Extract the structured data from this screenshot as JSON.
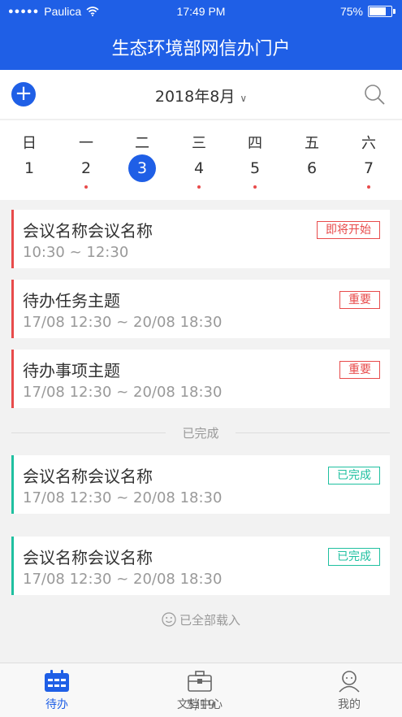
{
  "status": {
    "carrier": "Paulica",
    "time": "17:49 PM",
    "battery": "75%"
  },
  "header": {
    "title": "生态环境部网信办门户"
  },
  "toolbar": {
    "month": "2018年8月"
  },
  "week": [
    {
      "weekday": "日",
      "date": "1",
      "marked": false,
      "selected": false
    },
    {
      "weekday": "一",
      "date": "2",
      "marked": true,
      "selected": false
    },
    {
      "weekday": "二",
      "date": "3",
      "marked": false,
      "selected": true
    },
    {
      "weekday": "三",
      "date": "4",
      "marked": true,
      "selected": false
    },
    {
      "weekday": "四",
      "date": "5",
      "marked": true,
      "selected": false
    },
    {
      "weekday": "五",
      "date": "6",
      "marked": false,
      "selected": false
    },
    {
      "weekday": "六",
      "date": "7",
      "marked": true,
      "selected": false
    }
  ],
  "pending": [
    {
      "title": "会议名称会议名称",
      "time": "10:30 ~ 12:30",
      "badge": "即将开始"
    },
    {
      "title": "待办任务主题",
      "time": "17/08 12:30  ~ 20/08 18:30",
      "badge": "重要"
    },
    {
      "title": "待办事项主题",
      "time": "17/08 12:30  ~ 20/08 18:30",
      "badge": "重要"
    }
  ],
  "divider_label": "已完成",
  "completed": [
    {
      "title": "会议名称会议名称",
      "time": "17/08 12:30  ~ 20/08 18:30",
      "badge": "已完成"
    },
    {
      "title": "会议名称会议名称",
      "time": "17/08 12:30  ~ 20/08 18:30",
      "badge": "已完成"
    }
  ],
  "loaded_text": "已全部载入",
  "tabs": [
    {
      "label": "待办",
      "active": true
    },
    {
      "label": "文档中心",
      "active": false
    },
    {
      "label": "我的",
      "active": false
    }
  ],
  "page_indicator": "5/19",
  "colors": {
    "primary": "#1f5fe6",
    "important": "#e84b4b",
    "done": "#1fc0a0"
  }
}
